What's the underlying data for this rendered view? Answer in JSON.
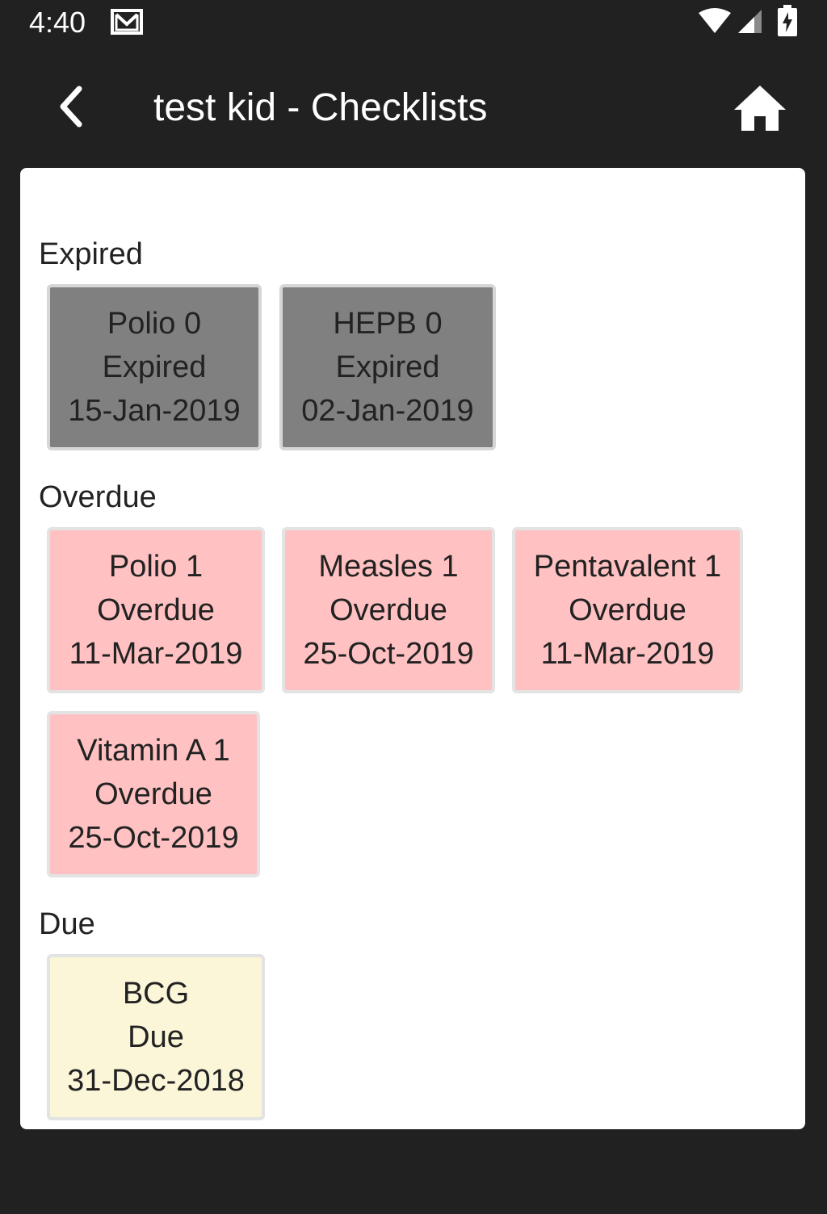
{
  "status_bar": {
    "time": "4:40",
    "icons": [
      "gmail-icon",
      "wifi-icon",
      "signal-icon",
      "battery-charging-icon"
    ]
  },
  "toolbar": {
    "back_icon": "chevron-left-icon",
    "title": "test kid - Checklists",
    "home_icon": "home-icon"
  },
  "colors": {
    "background": "#212121",
    "card": "#ffffff",
    "expired": "#808080",
    "overdue": "#ffc1c1",
    "due": "#fbf6d8"
  },
  "sections": [
    {
      "title": "Expired",
      "items": [
        {
          "name": "Polio 0",
          "status": "Expired",
          "date": "15-Jan-2019"
        },
        {
          "name": "HEPB 0",
          "status": "Expired",
          "date": "02-Jan-2019"
        }
      ]
    },
    {
      "title": "Overdue",
      "items": [
        {
          "name": "Polio 1",
          "status": "Overdue",
          "date": "11-Mar-2019"
        },
        {
          "name": "Measles 1",
          "status": "Overdue",
          "date": "25-Oct-2019"
        },
        {
          "name": "Pentavalent 1",
          "status": "Overdue",
          "date": "11-Mar-2019"
        },
        {
          "name": "Vitamin A 1",
          "status": "Overdue",
          "date": "25-Oct-2019"
        }
      ]
    },
    {
      "title": "Due",
      "items": [
        {
          "name": "BCG",
          "status": "Due",
          "date": "31-Dec-2018"
        }
      ]
    }
  ]
}
